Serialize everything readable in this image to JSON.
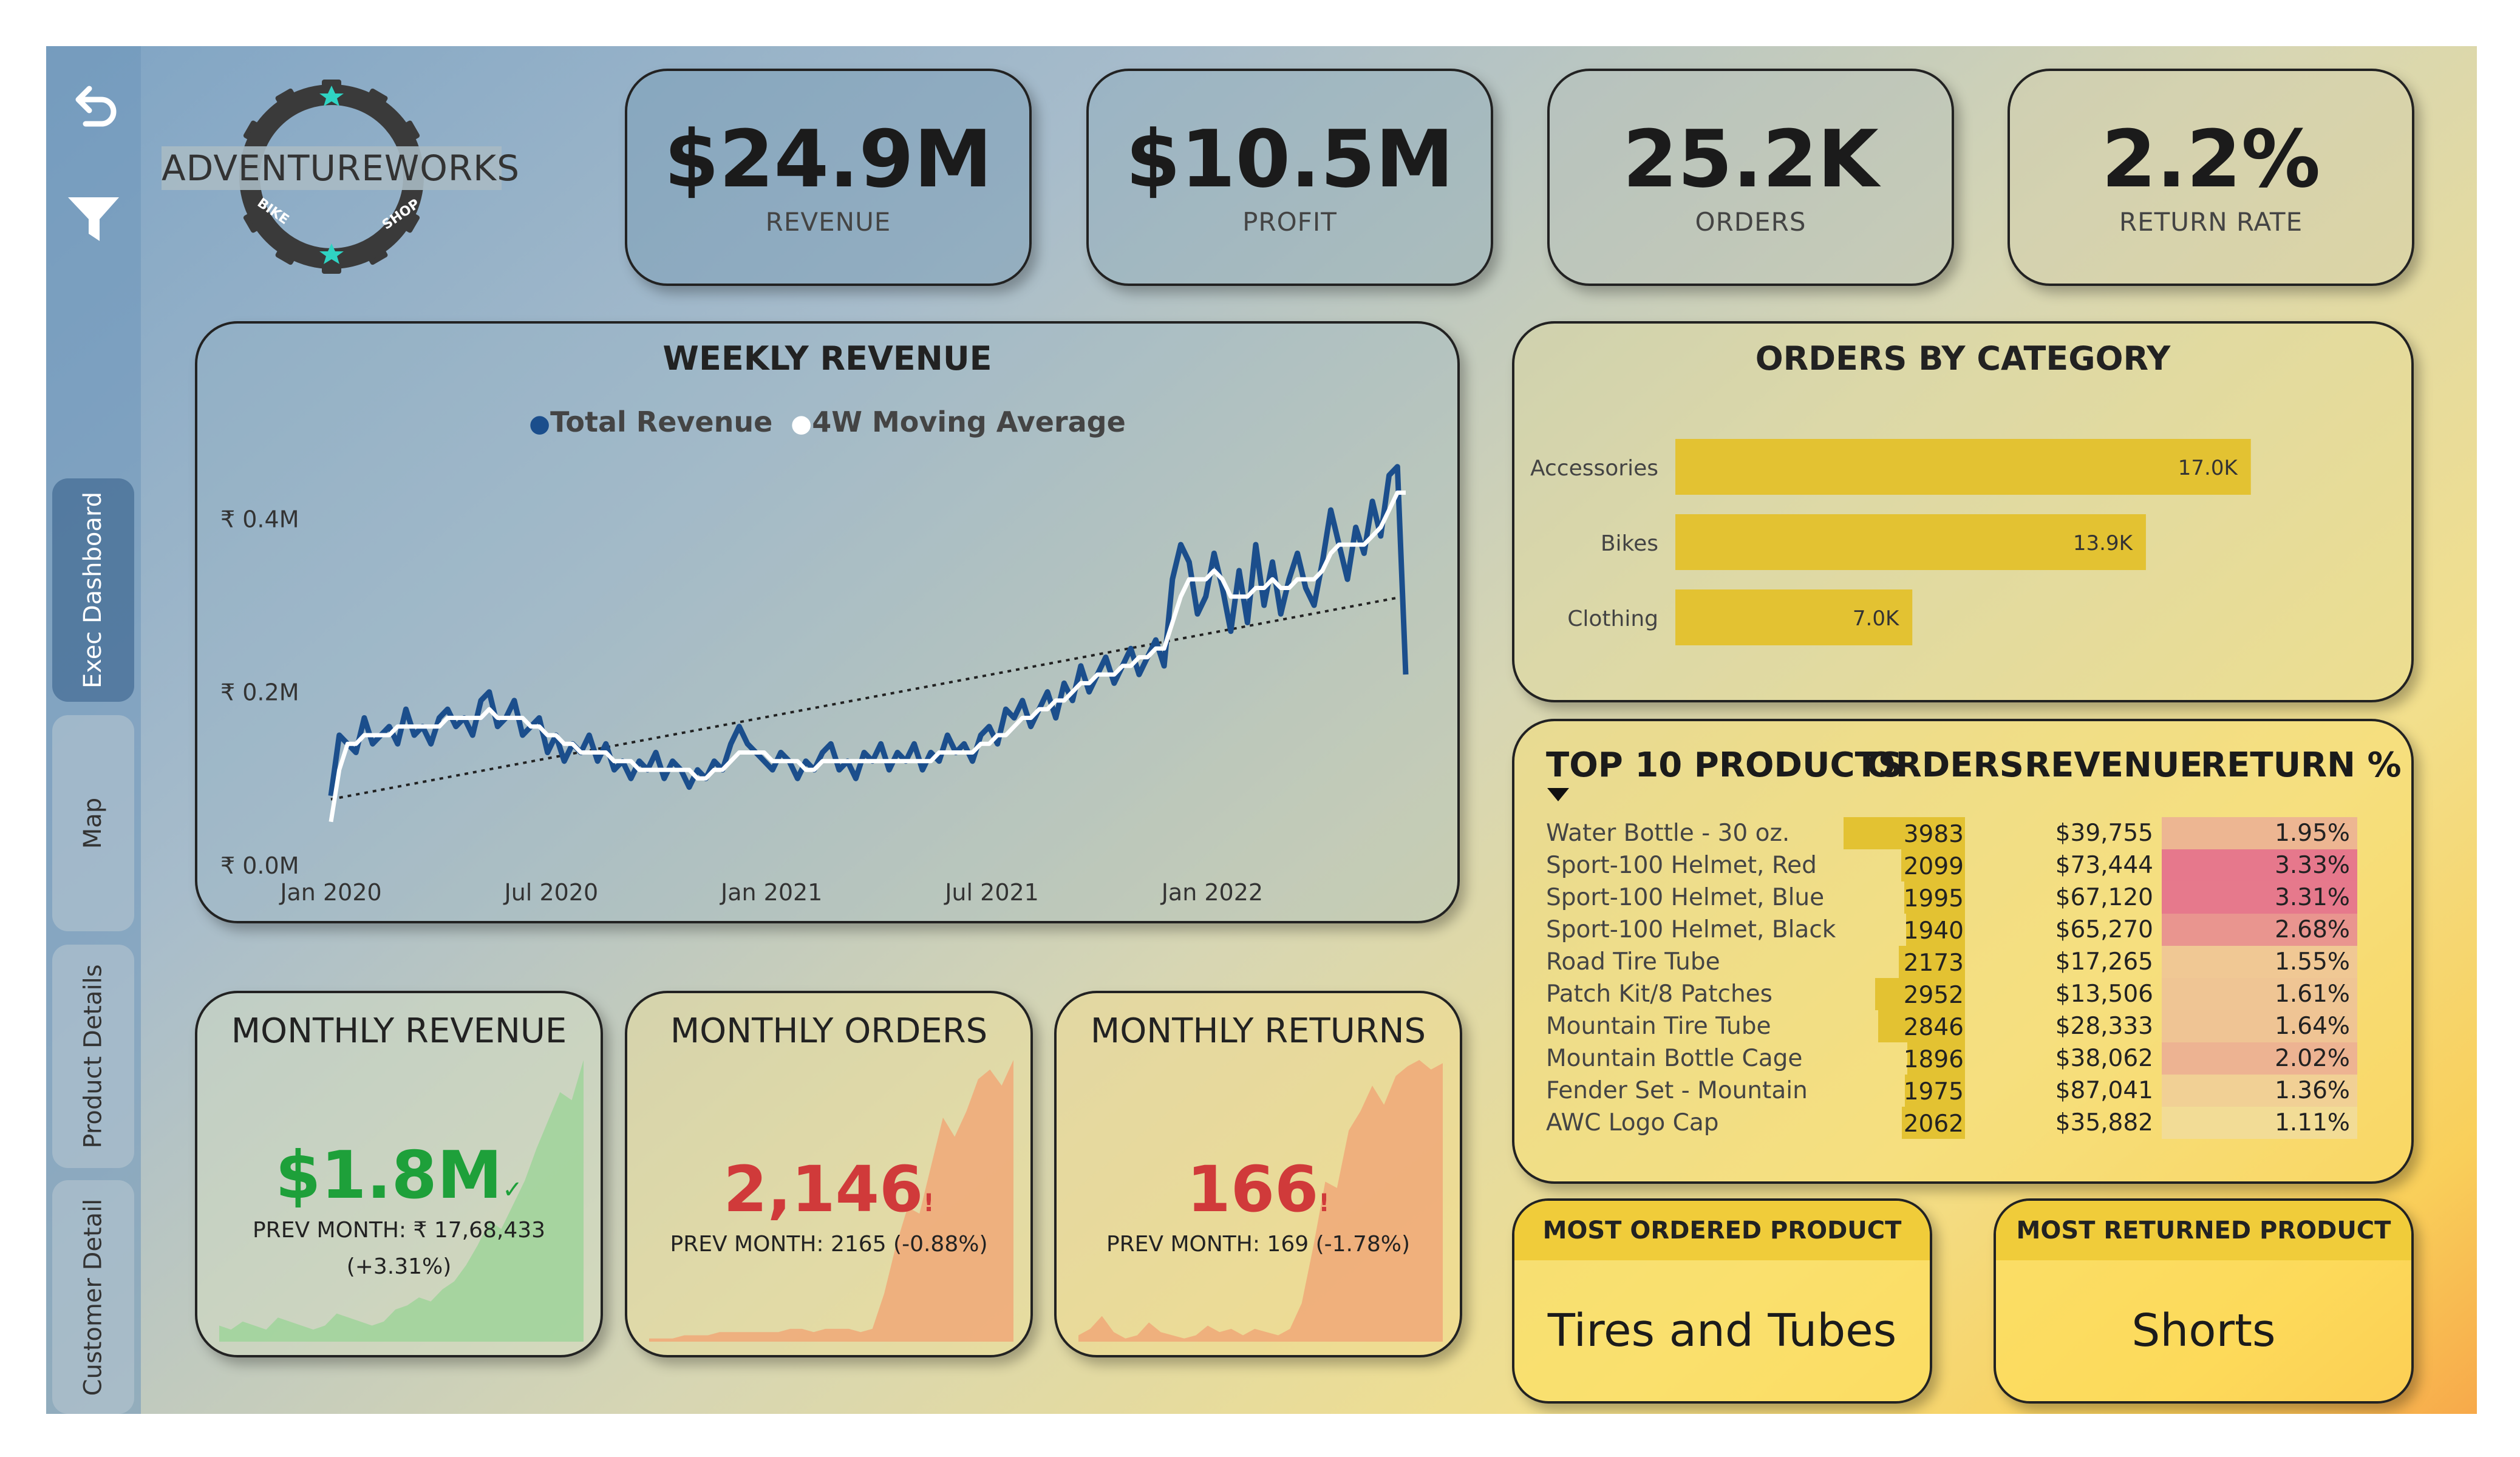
{
  "nav": {
    "tabs": [
      {
        "label": "Exec Dashboard",
        "active": true
      },
      {
        "label": "Map",
        "active": false
      },
      {
        "label": "Product Details",
        "active": false
      },
      {
        "label": "Customer Detail",
        "active": false
      }
    ],
    "back_icon": "back-arrow-icon",
    "filter_icon": "filter-funnel-icon"
  },
  "logo": {
    "brand": "ADVENTUREWORKS",
    "sub_left": "BIKE",
    "sub_right": "SHOP"
  },
  "kpis": [
    {
      "value": "$24.9M",
      "label": "REVENUE"
    },
    {
      "value": "$10.5M",
      "label": "PROFIT"
    },
    {
      "value": "25.2K",
      "label": "ORDERS"
    },
    {
      "value": "2.2%",
      "label": "RETURN RATE"
    }
  ],
  "weekly_revenue": {
    "title": "WEEKLY REVENUE",
    "legend": [
      "Total Revenue",
      "4W Moving Average"
    ],
    "y_ticks": [
      "₹ 0.4M",
      "₹ 0.2M",
      "₹ 0.0M"
    ],
    "x_ticks": [
      "Jan 2020",
      "Jul 2020",
      "Jan 2021",
      "Jul 2021",
      "Jan 2022"
    ],
    "colors": {
      "total": "#1b4e8c",
      "moving_avg": "#ffffff",
      "trend": "#222222"
    }
  },
  "orders_by_category": {
    "title": "ORDERS BY CATEGORY",
    "bar_color": "#e3c232"
  },
  "top_products": {
    "headers": [
      "TOP 10 PRODUCTS",
      "ORDERS",
      "REVENUE",
      "RETURN %"
    ],
    "sort_icon": "sort-down-triangle-icon",
    "rows": [
      {
        "name": "Water Bottle - 30 oz.",
        "orders": 3983,
        "orders_text": "3983",
        "revenue": "$39,755",
        "return_pct": 1.95,
        "return_text": "1.95%"
      },
      {
        "name": "Sport-100 Helmet, Red",
        "orders": 2099,
        "orders_text": "2099",
        "revenue": "$73,444",
        "return_pct": 3.33,
        "return_text": "3.33%"
      },
      {
        "name": "Sport-100 Helmet, Blue",
        "orders": 1995,
        "orders_text": "1995",
        "revenue": "$67,120",
        "return_pct": 3.31,
        "return_text": "3.31%"
      },
      {
        "name": "Sport-100 Helmet, Black",
        "orders": 1940,
        "orders_text": "1940",
        "revenue": "$65,270",
        "return_pct": 2.68,
        "return_text": "2.68%"
      },
      {
        "name": "Road Tire Tube",
        "orders": 2173,
        "orders_text": "2173",
        "revenue": "$17,265",
        "return_pct": 1.55,
        "return_text": "1.55%"
      },
      {
        "name": "Patch Kit/8 Patches",
        "orders": 2952,
        "orders_text": "2952",
        "revenue": "$13,506",
        "return_pct": 1.61,
        "return_text": "1.61%"
      },
      {
        "name": "Mountain Tire Tube",
        "orders": 2846,
        "orders_text": "2846",
        "revenue": "$28,333",
        "return_pct": 1.64,
        "return_text": "1.64%"
      },
      {
        "name": "Mountain Bottle Cage",
        "orders": 1896,
        "orders_text": "1896",
        "revenue": "$38,062",
        "return_pct": 2.02,
        "return_text": "2.02%"
      },
      {
        "name": "Fender Set - Mountain",
        "orders": 1975,
        "orders_text": "1975",
        "revenue": "$87,041",
        "return_pct": 1.36,
        "return_text": "1.36%"
      },
      {
        "name": "AWC Logo Cap",
        "orders": 2062,
        "orders_text": "2062",
        "revenue": "$35,882",
        "return_pct": 1.11,
        "return_text": "1.11%"
      }
    ]
  },
  "monthly_revenue": {
    "title": "MONTHLY REVENUE",
    "value": "$1.8M",
    "mark": "✓",
    "prev": "PREV MONTH: ₹ 17,68,433",
    "change": "(+3.31%)",
    "value_color": "#1ea03a",
    "area_color": "#9fd39a",
    "series": [
      4,
      3,
      5,
      4,
      3,
      6,
      5,
      4,
      3,
      4,
      7,
      6,
      5,
      4,
      5,
      8,
      9,
      11,
      10,
      13,
      15,
      19,
      24,
      30,
      28,
      34,
      40,
      48,
      55,
      62,
      60,
      70
    ]
  },
  "monthly_orders": {
    "title": "MONTHLY ORDERS",
    "value": "2,146",
    "mark": "!",
    "prev": "PREV MONTH: 2165 (-0.88%)",
    "value_color": "#d03a3a",
    "area_color": "#f0a878",
    "series": [
      1,
      1,
      1,
      2,
      2,
      2,
      3,
      3,
      3,
      3,
      3,
      3,
      4,
      4,
      3,
      4,
      4,
      4,
      3,
      4,
      15,
      30,
      42,
      40,
      55,
      70,
      64,
      72,
      82,
      85,
      80,
      88
    ]
  },
  "monthly_returns": {
    "title": "MONTHLY RETURNS",
    "value": "166",
    "mark": "!",
    "prev": "PREV MONTH: 169 (-1.78%)",
    "value_color": "#d03a3a",
    "area_color": "#f0a878",
    "series": [
      2,
      4,
      8,
      3,
      1,
      2,
      6,
      3,
      2,
      1,
      2,
      5,
      3,
      4,
      2,
      4,
      3,
      2,
      4,
      12,
      30,
      50,
      48,
      66,
      72,
      80,
      74,
      83,
      86,
      88,
      85,
      87
    ]
  },
  "most_ordered": {
    "label": "MOST ORDERED PRODUCT",
    "value": "Tires and Tubes"
  },
  "most_returned": {
    "label": "MOST RETURNED PRODUCT",
    "value": "Shorts"
  },
  "chart_data": [
    {
      "type": "line",
      "title": "WEEKLY REVENUE",
      "xlabel": "",
      "ylabel": "",
      "x": [
        "2020-01-01",
        "2022-06-26"
      ],
      "ylim": [
        0,
        0.45
      ],
      "series": [
        {
          "name": "Total Revenue",
          "values": [
            0.08,
            0.15,
            0.14,
            0.13,
            0.17,
            0.14,
            0.15,
            0.16,
            0.14,
            0.18,
            0.15,
            0.16,
            0.14,
            0.17,
            0.18,
            0.16,
            0.17,
            0.15,
            0.19,
            0.2,
            0.16,
            0.17,
            0.19,
            0.15,
            0.16,
            0.17,
            0.13,
            0.15,
            0.12,
            0.14,
            0.13,
            0.15,
            0.12,
            0.14,
            0.11,
            0.12,
            0.1,
            0.12,
            0.11,
            0.13,
            0.1,
            0.12,
            0.11,
            0.09,
            0.11,
            0.1,
            0.12,
            0.11,
            0.14,
            0.16,
            0.14,
            0.13,
            0.12,
            0.11,
            0.13,
            0.12,
            0.1,
            0.12,
            0.11,
            0.13,
            0.14,
            0.11,
            0.12,
            0.1,
            0.13,
            0.12,
            0.14,
            0.11,
            0.13,
            0.12,
            0.14,
            0.11,
            0.13,
            0.12,
            0.15,
            0.13,
            0.14,
            0.12,
            0.15,
            0.16,
            0.14,
            0.18,
            0.17,
            0.19,
            0.16,
            0.18,
            0.2,
            0.17,
            0.21,
            0.19,
            0.23,
            0.2,
            0.22,
            0.24,
            0.21,
            0.23,
            0.25,
            0.22,
            0.24,
            0.26,
            0.23,
            0.33,
            0.37,
            0.35,
            0.29,
            0.31,
            0.36,
            0.32,
            0.27,
            0.34,
            0.28,
            0.37,
            0.3,
            0.35,
            0.29,
            0.33,
            0.36,
            0.32,
            0.3,
            0.35,
            0.41,
            0.37,
            0.33,
            0.39,
            0.36,
            0.42,
            0.38,
            0.45,
            0.46,
            0.22
          ]
        },
        {
          "name": "4W Moving Average",
          "values": [
            0.05,
            0.11,
            0.14,
            0.14,
            0.15,
            0.15,
            0.15,
            0.15,
            0.16,
            0.16,
            0.16,
            0.16,
            0.16,
            0.16,
            0.17,
            0.17,
            0.17,
            0.17,
            0.17,
            0.18,
            0.17,
            0.17,
            0.17,
            0.17,
            0.16,
            0.16,
            0.15,
            0.15,
            0.14,
            0.14,
            0.13,
            0.13,
            0.13,
            0.13,
            0.12,
            0.12,
            0.12,
            0.11,
            0.11,
            0.11,
            0.11,
            0.11,
            0.11,
            0.11,
            0.1,
            0.1,
            0.11,
            0.11,
            0.12,
            0.13,
            0.13,
            0.13,
            0.13,
            0.12,
            0.12,
            0.12,
            0.12,
            0.11,
            0.11,
            0.12,
            0.12,
            0.12,
            0.12,
            0.12,
            0.12,
            0.12,
            0.12,
            0.12,
            0.12,
            0.12,
            0.12,
            0.12,
            0.12,
            0.13,
            0.13,
            0.13,
            0.13,
            0.13,
            0.14,
            0.14,
            0.15,
            0.15,
            0.16,
            0.17,
            0.17,
            0.18,
            0.18,
            0.19,
            0.19,
            0.2,
            0.21,
            0.21,
            0.22,
            0.22,
            0.22,
            0.23,
            0.23,
            0.24,
            0.24,
            0.25,
            0.25,
            0.28,
            0.31,
            0.33,
            0.33,
            0.33,
            0.34,
            0.33,
            0.31,
            0.31,
            0.31,
            0.32,
            0.32,
            0.33,
            0.32,
            0.32,
            0.33,
            0.33,
            0.33,
            0.34,
            0.36,
            0.37,
            0.37,
            0.37,
            0.37,
            0.38,
            0.39,
            0.41,
            0.43,
            0.43
          ]
        }
      ]
    },
    {
      "type": "bar",
      "title": "ORDERS BY CATEGORY",
      "categories": [
        "Accessories",
        "Bikes",
        "Clothing"
      ],
      "values": [
        17.0,
        13.9,
        7.0
      ],
      "value_labels": [
        "17.0K",
        "13.9K",
        "7.0K"
      ],
      "xlim": [
        0,
        20
      ]
    }
  ]
}
